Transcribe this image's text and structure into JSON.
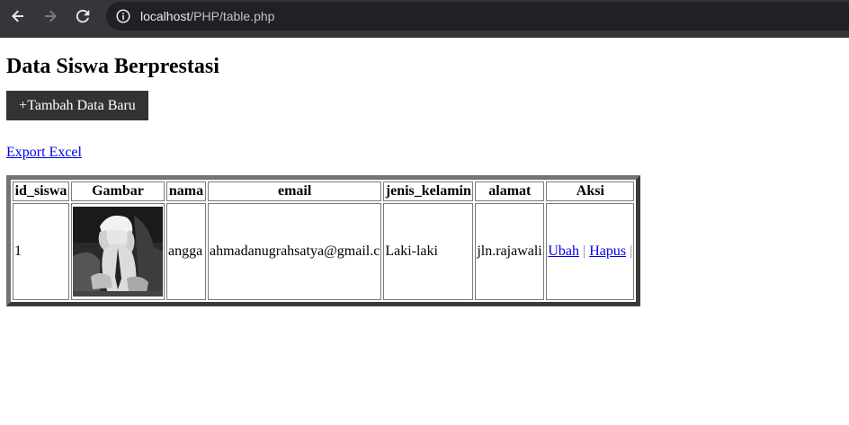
{
  "browser": {
    "url_host": "localhost",
    "url_path": "/PHP/table.php"
  },
  "page": {
    "title": "Data Siswa Berprestasi",
    "add_button_label": "+Tambah Data Baru",
    "export_link_label": "Export Excel"
  },
  "table": {
    "headers": [
      "id_siswa",
      "Gambar",
      "nama",
      "email",
      "jenis_kelamin",
      "alamat",
      "Aksi"
    ],
    "rows": [
      {
        "id_siswa": "1",
        "nama": "angga",
        "email": "ahmadanugrahsatya@gmail.c",
        "jenis_kelamin": "Laki-laki",
        "alamat": "jln.rajawali",
        "actions": [
          "Ubah",
          "Hapus"
        ],
        "separator": "|"
      }
    ]
  },
  "colors": {
    "chrome_bg": "#35363a",
    "omnibox_bg": "#202124",
    "button_bg": "#333333",
    "link": "#0000ee"
  }
}
